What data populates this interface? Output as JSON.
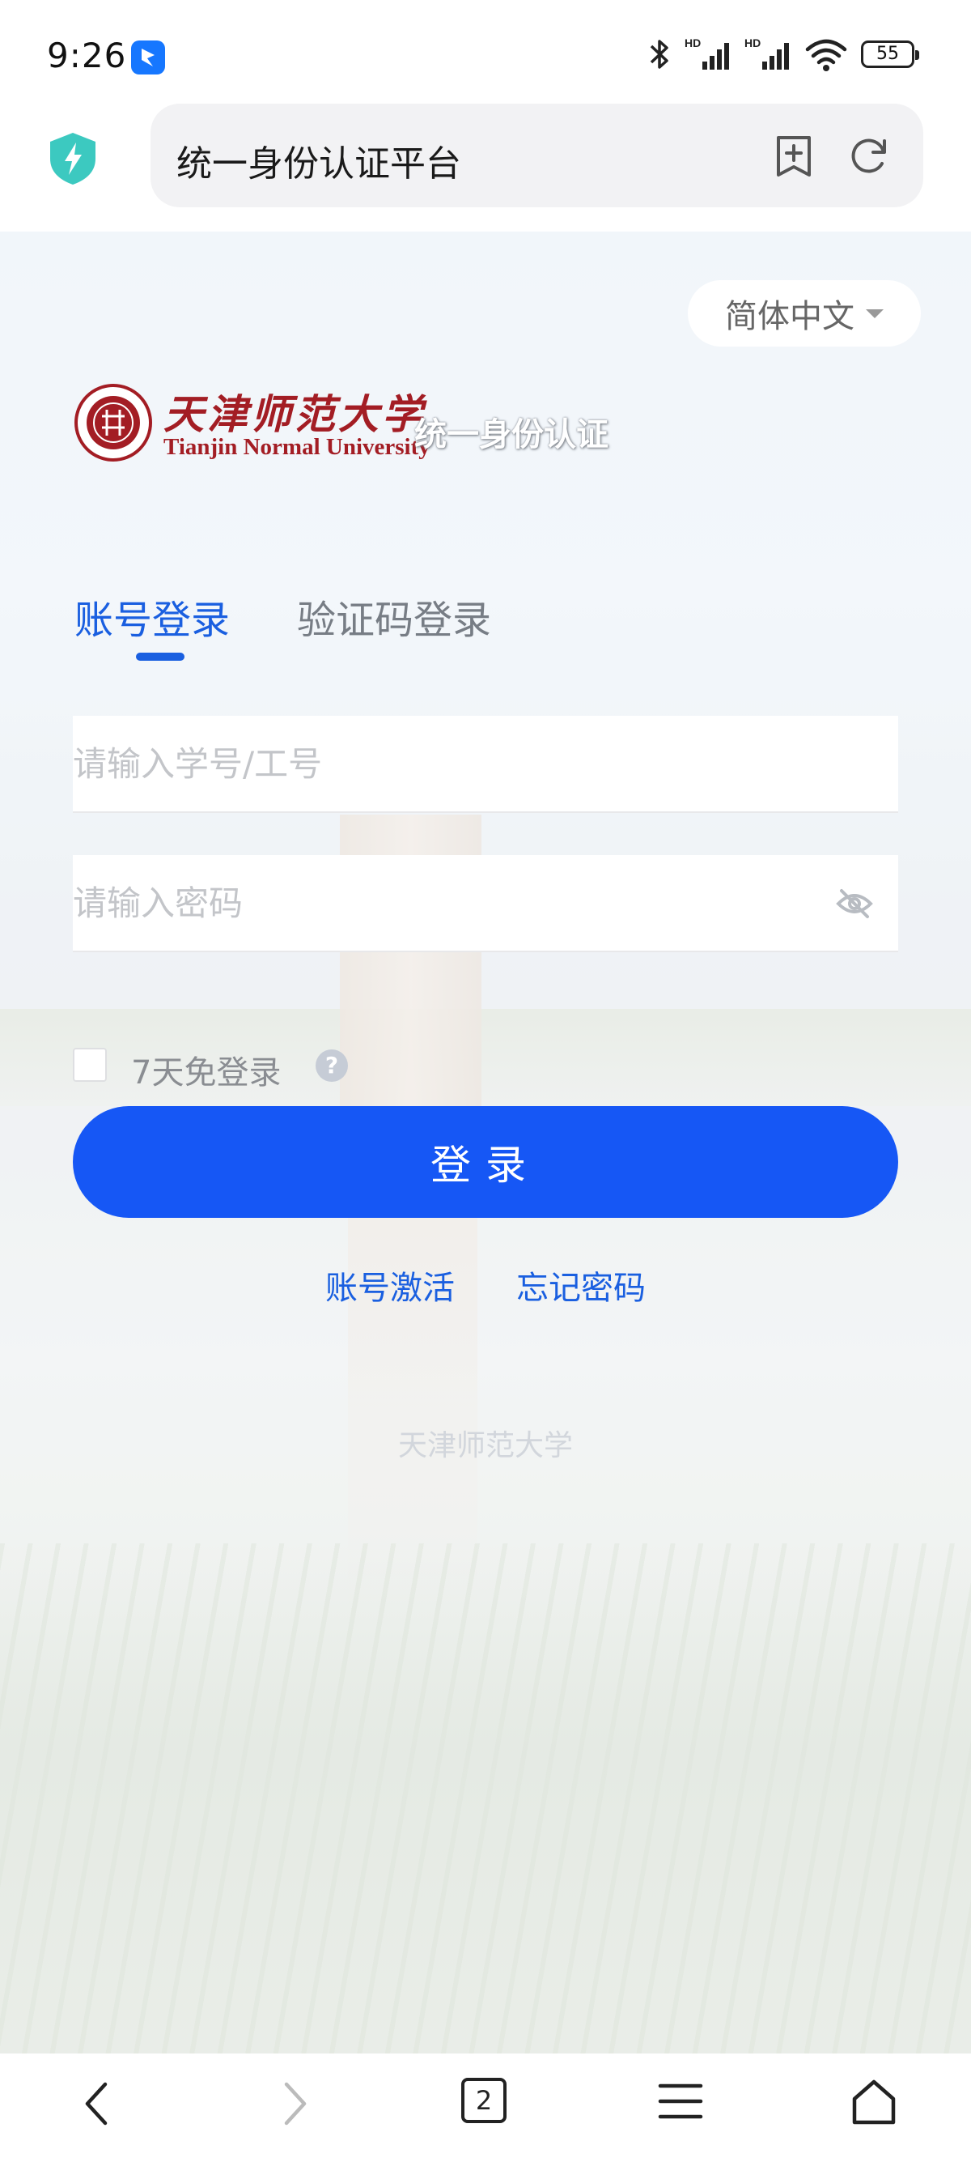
{
  "status_bar": {
    "time": "9:26",
    "app_icon": "notification-app-icon",
    "bluetooth_icon": "bluetooth-icon",
    "signal1_label": "HD",
    "signal2_label": "HD",
    "wifi_icon": "wifi-icon",
    "battery_level": "55"
  },
  "browser": {
    "shield_icon": "shield-lightning-icon",
    "address_title": "统一身份认证平台",
    "bookmark_icon": "bookmark-add-icon",
    "refresh_icon": "refresh-icon"
  },
  "page": {
    "language": "简体中文",
    "logo": {
      "cn_name": "天津师范大学",
      "en_name": "Tianjin Normal University",
      "subtitle": "统一身份认证"
    },
    "tabs": [
      {
        "label": "账号登录",
        "active": true
      },
      {
        "label": "验证码登录",
        "active": false
      }
    ],
    "username_placeholder": "请输入学号/工号",
    "password_placeholder": "请输入密码",
    "remember_label": "7天免登录",
    "help_glyph": "?",
    "login_button": "登录",
    "links": {
      "activate": "账号激活",
      "forgot": "忘记密码"
    },
    "footer": "天津师范大学"
  },
  "bottom_nav": {
    "tab_count": "2"
  },
  "colors": {
    "primary": "#1657f5",
    "link": "#1a5fe0",
    "brand_red": "#a31d24"
  }
}
